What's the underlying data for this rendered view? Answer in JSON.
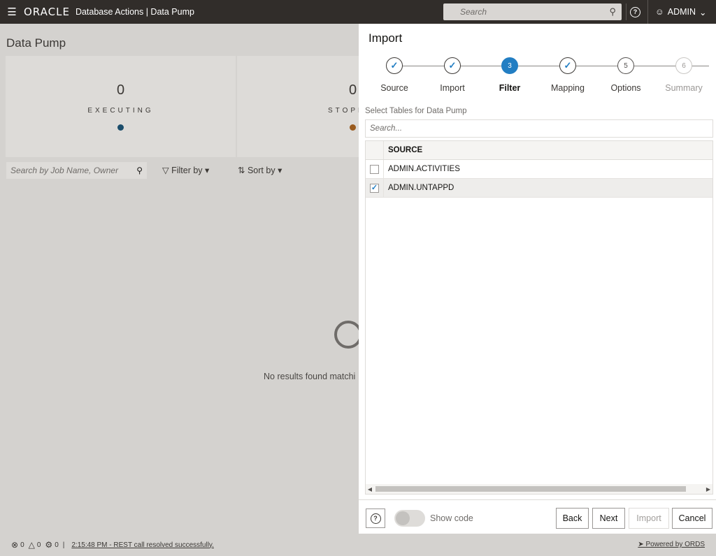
{
  "header": {
    "brand": "ORACLE",
    "product": "Database Actions | Data Pump",
    "search_placeholder": "Search",
    "user": "ADMIN",
    "icons": [
      "hamburger-icon",
      "search-icon",
      "help-icon",
      "user-icon",
      "chevron-down-icon"
    ]
  },
  "page": {
    "title": "Data Pump",
    "cards": [
      {
        "count": "0",
        "label": "EXECUTING",
        "dot_color": "#1b4d6b"
      },
      {
        "count": "0",
        "label": "STOPP",
        "dot_color": "#9a5b1e"
      }
    ],
    "search_placeholder": "Search by Job Name, Owner",
    "filter_label": "Filter by",
    "sort_label": "Sort by",
    "empty_text": "No results found matchi"
  },
  "status_bar": {
    "errors": "0",
    "warnings": "0",
    "tasks": "0",
    "message": "2:15:48 PM - REST call resolved successfully.",
    "powered_by": "Powered by ORDS"
  },
  "drawer": {
    "title": "Import",
    "steps": [
      {
        "number": "✓",
        "label": "Source",
        "state": "done"
      },
      {
        "number": "✓",
        "label": "Import",
        "state": "done"
      },
      {
        "number": "3",
        "label": "Filter",
        "state": "current"
      },
      {
        "number": "✓",
        "label": "Mapping",
        "state": "done"
      },
      {
        "number": "5",
        "label": "Options",
        "state": "pending"
      },
      {
        "number": "6",
        "label": "Summary",
        "state": "disabled"
      }
    ],
    "section_label": "Select Tables for Data Pump",
    "table_search_placeholder": "Search...",
    "table": {
      "header": "SOURCE",
      "rows": [
        {
          "name": "ADMIN.ACTIVITIES",
          "checked": false
        },
        {
          "name": "ADMIN.UNTAPPD",
          "checked": true
        }
      ]
    },
    "footer": {
      "show_code_label": "Show code",
      "back": "Back",
      "next": "Next",
      "import": "Import",
      "cancel": "Cancel"
    }
  },
  "colors": {
    "topbar": "#312d2a",
    "accent": "#227ec3"
  }
}
